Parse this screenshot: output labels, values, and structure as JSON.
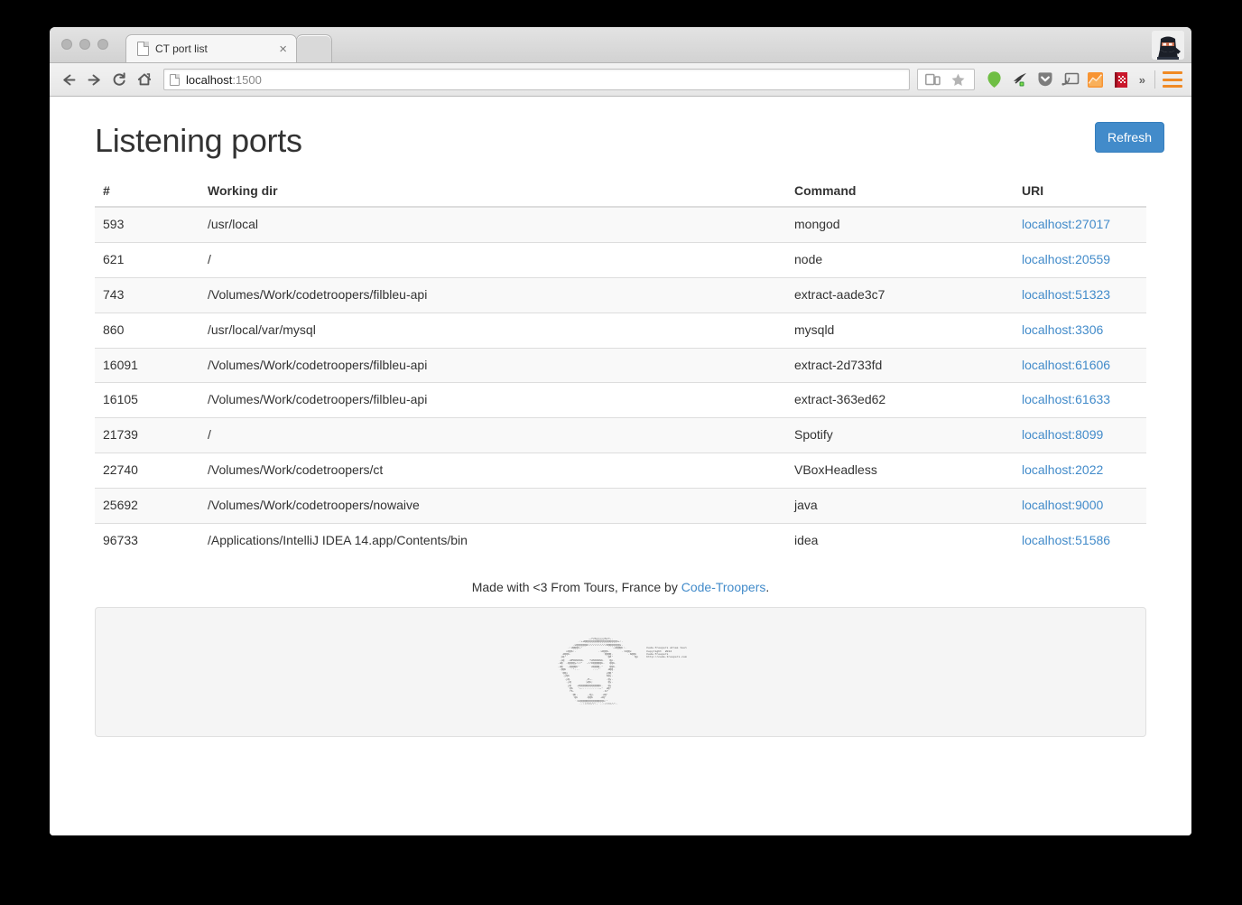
{
  "browser": {
    "tab": {
      "title": "CT port list",
      "favicon": "page-icon",
      "close": "×"
    },
    "ghost_tab_label": "",
    "nav": {
      "back": "←",
      "forward": "→",
      "reload": "⟳",
      "home": "⌂"
    },
    "omnibox": {
      "host": "localhost",
      "port": ":1500",
      "full": "localhost:1500"
    },
    "bookmark": {
      "devices_icon": "device-toggle-icon",
      "star_icon": "star-icon"
    },
    "extensions": [
      {
        "name": "evernote-icon",
        "color": "#6fbe44"
      },
      {
        "name": "ghostery-icon",
        "color": "#3c3c3c"
      },
      {
        "name": "pocket-icon",
        "color": "#8c8c8c"
      },
      {
        "name": "chromecast-icon",
        "color": "#6e6e6e"
      },
      {
        "name": "analytics-icon",
        "color": "#f79433"
      },
      {
        "name": "bookmark-manager-icon",
        "color": "#c9172b"
      }
    ],
    "overflow_label": "»",
    "menu_label": "chrome-menu",
    "avatar_label": "ninja-avatar"
  },
  "page": {
    "title": "Listening ports",
    "refresh_label": "Refresh",
    "accent_color": "#428bca",
    "link_color": "#428bca",
    "footer_text_before": "Made with <3 From Tours, France by ",
    "footer_link": "Code-Troopers",
    "footer_text_after": "."
  },
  "table": {
    "columns": [
      "#",
      "Working dir",
      "Command",
      "URI"
    ],
    "rows": [
      {
        "num": "593",
        "dir": "/usr/local",
        "cmd": "mongod",
        "uri": "localhost:27017"
      },
      {
        "num": "621",
        "dir": "/",
        "cmd": "node",
        "uri": "localhost:20559"
      },
      {
        "num": "743",
        "dir": "/Volumes/Work/codetroopers/filbleu-api",
        "cmd": "extract-aade3c7",
        "uri": "localhost:51323"
      },
      {
        "num": "860",
        "dir": "/usr/local/var/mysql",
        "cmd": "mysqld",
        "uri": "localhost:3306"
      },
      {
        "num": "16091",
        "dir": "/Volumes/Work/codetroopers/filbleu-api",
        "cmd": "extract-2d733fd",
        "uri": "localhost:61606"
      },
      {
        "num": "16105",
        "dir": "/Volumes/Work/codetroopers/filbleu-api",
        "cmd": "extract-363ed62",
        "uri": "localhost:61633"
      },
      {
        "num": "21739",
        "dir": "/",
        "cmd": "Spotify",
        "uri": "localhost:8099"
      },
      {
        "num": "22740",
        "dir": "/Volumes/Work/codetroopers/ct",
        "cmd": "VBoxHeadless",
        "uri": "localhost:2022"
      },
      {
        "num": "25692",
        "dir": "/Volumes/Work/codetroopers/nowaive",
        "cmd": "java",
        "uri": "localhost:9000"
      },
      {
        "num": "96733",
        "dir": "/Applications/IntelliJ IDEA 14.app/Contents/bin",
        "cmd": "idea",
        "uri": "localhost:51586"
      }
    ]
  },
  "ascii_banner": {
    "credit_line_1": "Code-Troopers atlas tool",
    "credit_line_2": "Copyright  2014",
    "credit_line_3": "Code-Troopers",
    "credit_line_4": "http://code-troopers.com",
    "art": "                    .~?x%yyyyy%x?~.                                          \n              .:+dQQQQQQQQQQQQQQQQQQQb+:.                                   \n           .xQQQQQQ#///////////#QQQQQQQx.                                   \n        .:dQQQb~'                 `~dQQQb:.            Code-Troopers atlas tool\n       xQQb:.             .:dQQb.       .:bQQx         Copyright  2014        \n     dQQb.                   `QQQQ.         .bQQb      Code-Troopers          \n    pQ'                        `Q#'            `Qp     http://code-troopers.com\n   .pQ  .dP%%%%%b.   ?d%%%%%b.   Qp.                                        \n  .dQ  -QQQQy///'  .//#QQQQQb-   QQb.                                       \n  .dQ  `-QQQQb'      `dQQQQ-'    QQb.                                       \n   .QQb   `'-..        ..-'`    dQQ.                                        \n    `QQy                       yQQ'                                         \n     .yQb                      bQy.                                         \n      .yQ.         ,P~.        .Qy.                                         \n       .yQ         yQb;         Qy.                                         \n        yQ   .dQQQQQQQQQQQQb.   Qy                                          \n        `Qb   '~-.........-~'  dQ'                                          \n         ?b.                 .b?                                            \n          `Qb.      ,Qy.    .dQ'                                            \n           `Qb     .QQb    .dQ'                                             \n            `:bQQQQQQQQQQQQQQb:'                                            \n               ..://==//:-`..://==//:.                                      "
  }
}
